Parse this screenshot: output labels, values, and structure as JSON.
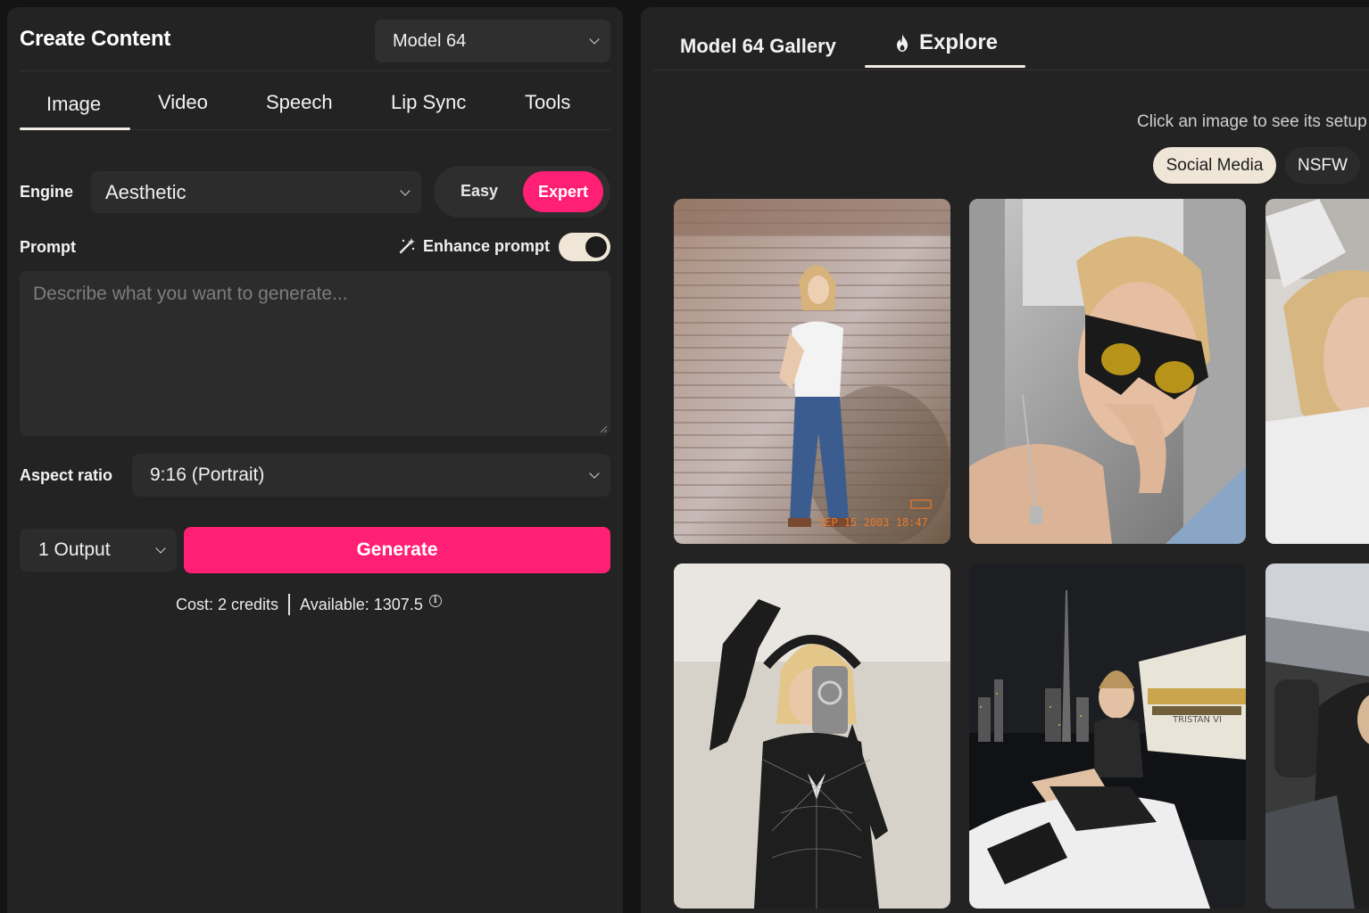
{
  "create": {
    "title": "Create Content",
    "model_selected": "Model 64"
  },
  "tabs": [
    "Image",
    "Video",
    "Speech",
    "Lip Sync",
    "Tools"
  ],
  "engine": {
    "label": "Engine",
    "value": "Aesthetic",
    "mode_easy": "Easy",
    "mode_expert": "Expert",
    "active_mode": "Expert"
  },
  "prompt": {
    "label": "Prompt",
    "enhance_label": "Enhance prompt",
    "enhance_on": true,
    "placeholder": "Describe what you want to generate...",
    "value": ""
  },
  "aspect": {
    "label": "Aspect ratio",
    "value": "9:16 (Portrait)"
  },
  "output": {
    "value": "1 Output",
    "generate_label": "Generate"
  },
  "cost": {
    "cost_text": "Cost: 2 credits",
    "available_text": "Available: 1307.5"
  },
  "gallery": {
    "tab_gallery": "Model 64 Gallery",
    "tab_explore": "Explore",
    "hint": "Click an image to see its setup",
    "filters": [
      "Social Media",
      "NSFW"
    ],
    "active_filter": "Social Media",
    "tiles": [
      {
        "icon": "photo-woman-white-tee-jeans"
      },
      {
        "icon": "photo-woman-yellow-sunglasses"
      },
      {
        "icon": "photo-woman-lying-bed"
      },
      {
        "icon": "photo-woman-spider-suit-mirror-selfie"
      },
      {
        "icon": "photo-woman-jetski-night-city"
      },
      {
        "icon": "photo-car-interior-selfie"
      }
    ],
    "stamp": "SEP 15 2003 18:47"
  },
  "colors": {
    "accent_pink": "#ff1f75",
    "cream": "#f0e6d8",
    "panel_bg": "#232323",
    "page_bg": "#141414"
  }
}
